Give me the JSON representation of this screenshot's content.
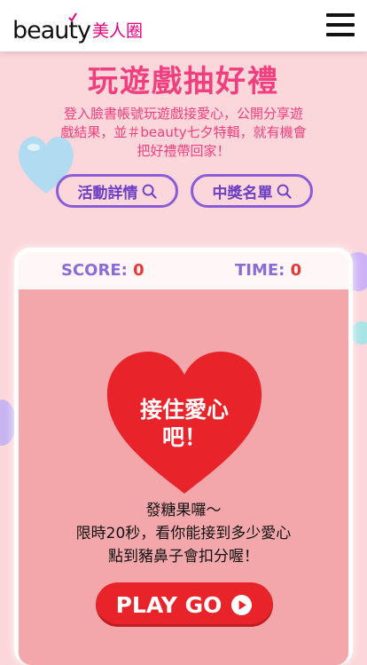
{
  "header": {
    "logo_en": "beauty",
    "logo_zh": "美人圈",
    "menu_icon": "hamburger-menu-icon"
  },
  "hero": {
    "title": "玩遊戲抽好禮",
    "desc_line1": "登入臉書帳號玩遊戲接愛心，公開分享遊",
    "desc_line2": "戲結果，並＃beauty七夕特輯，就有機會",
    "desc_line3": "把好禮帶回家！"
  },
  "buttons": {
    "event_details": "活動詳情",
    "winners_list": "中獎名單",
    "search_icon": "search-icon"
  },
  "game": {
    "score_label": "SCORE:",
    "score_value": "0",
    "time_label": "TIME:",
    "time_value": "0",
    "heart_line1": "接住愛心",
    "heart_line2": "吧！",
    "rule_line1": "發糖果囉～",
    "rule_line2": "限時20秒，看你能接到多少愛心",
    "rule_line3": "點到豬鼻子會扣分喔！",
    "play_label": "PLAY GO",
    "play_icon": "play-circle-icon"
  },
  "colors": {
    "accent_pink": "#ef3f7f",
    "purple": "#8b5cd6",
    "heart_red": "#e8242a",
    "background": "#fbd6da"
  }
}
